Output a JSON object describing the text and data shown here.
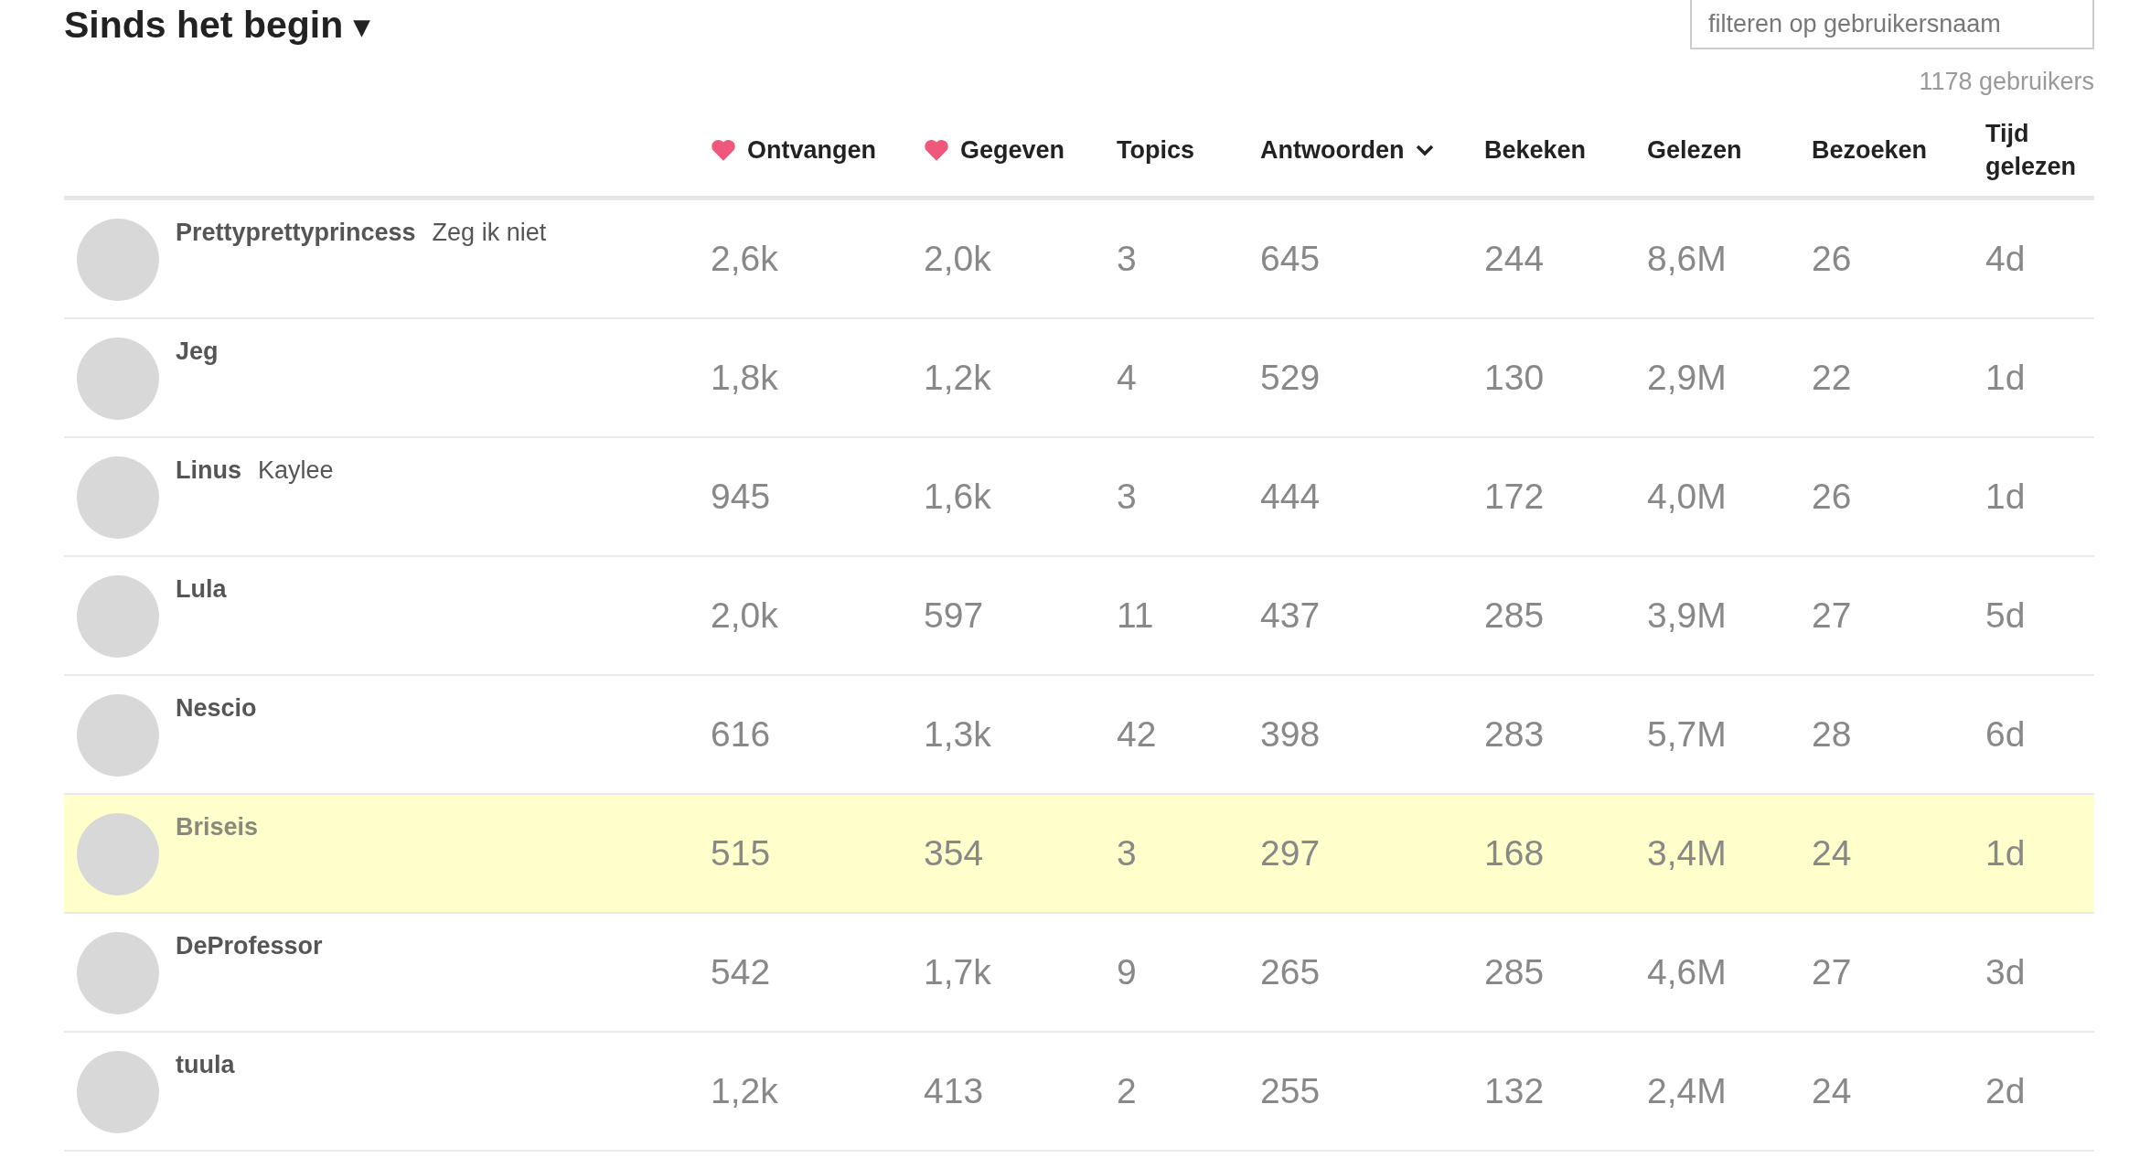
{
  "period": {
    "label": "Sinds het begin",
    "caret": "▾"
  },
  "filter": {
    "placeholder": "filteren op gebruikersnaam"
  },
  "user_count": "1178 gebruikers",
  "columns": [
    {
      "label": "Ontvangen",
      "heart": true,
      "sorted": false
    },
    {
      "label": "Gegeven",
      "heart": true,
      "sorted": false
    },
    {
      "label": "Topics",
      "heart": false,
      "sorted": false
    },
    {
      "label": "Antwoorden",
      "heart": false,
      "sorted": true
    },
    {
      "label": "Bekeken",
      "heart": false,
      "sorted": false
    },
    {
      "label": "Gelezen",
      "heart": false,
      "sorted": false
    },
    {
      "label": "Bezoeken",
      "heart": false,
      "sorted": false
    },
    {
      "label": "Tijd gelezen",
      "heart": false,
      "sorted": false
    }
  ],
  "rows": [
    {
      "name": "Prettyprettyprincess",
      "title": "Zeg ik niet",
      "selected": false,
      "values": [
        "2,6k",
        "2,0k",
        "3",
        "645",
        "244",
        "8,6M",
        "26",
        "4d"
      ]
    },
    {
      "name": "Jeg",
      "selected": false,
      "values": [
        "1,8k",
        "1,2k",
        "4",
        "529",
        "130",
        "2,9M",
        "22",
        "1d"
      ]
    },
    {
      "name": "Linus",
      "title": "Kaylee",
      "selected": false,
      "values": [
        "945",
        "1,6k",
        "3",
        "444",
        "172",
        "4,0M",
        "26",
        "1d"
      ]
    },
    {
      "name": "Lula",
      "selected": false,
      "values": [
        "2,0k",
        "597",
        "11",
        "437",
        "285",
        "3,9M",
        "27",
        "5d"
      ]
    },
    {
      "name": "Nescio",
      "selected": false,
      "values": [
        "616",
        "1,3k",
        "42",
        "398",
        "283",
        "5,7M",
        "28",
        "6d"
      ]
    },
    {
      "name": "Briseis",
      "selected": true,
      "values": [
        "515",
        "354",
        "3",
        "297",
        "168",
        "3,4M",
        "24",
        "1d"
      ]
    },
    {
      "name": "DeProfessor",
      "selected": false,
      "values": [
        "542",
        "1,7k",
        "9",
        "265",
        "285",
        "4,6M",
        "27",
        "3d"
      ]
    },
    {
      "name": "tuula",
      "selected": false,
      "values": [
        "1,2k",
        "413",
        "2",
        "255",
        "132",
        "2,4M",
        "24",
        "2d"
      ]
    }
  ]
}
